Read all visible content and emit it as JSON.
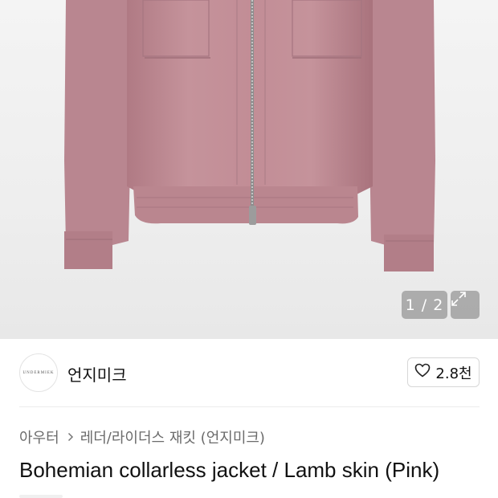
{
  "product": {
    "image_counter": "1 / 2",
    "title": "Bohemian collarless jacket / Lamb skin (Pink)"
  },
  "brand": {
    "name": "언지미크",
    "logo_text": "UNDERMIEK",
    "likes": "2.8천"
  },
  "breadcrumb": {
    "items": [
      "아우터",
      "레더/라이더스 재킷 (언지미크)"
    ]
  },
  "colors": {
    "jacket": "#c08a93",
    "accent_text": "#111111",
    "muted_text": "#6b6b6b"
  },
  "icons": {
    "expand": "expand-icon",
    "heart": "heart-icon",
    "chevron": "chevron-right-icon"
  }
}
